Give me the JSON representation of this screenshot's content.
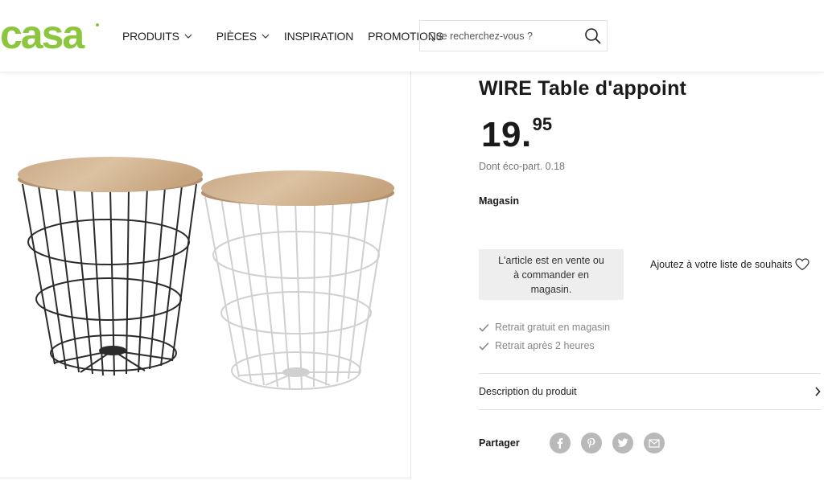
{
  "brand": {
    "logo_text": "casa",
    "accent": "#8cc63e"
  },
  "nav": {
    "items": [
      {
        "label": "PRODUITS",
        "has_dropdown": true
      },
      {
        "label": "PIÈCES",
        "has_dropdown": true
      },
      {
        "label": "INSPIRATION",
        "has_dropdown": false
      },
      {
        "label": "PROMOTIONS",
        "has_dropdown": false
      }
    ]
  },
  "search": {
    "placeholder": "Que recherchez-vous ?",
    "value": ""
  },
  "product": {
    "title": "WIRE Table d'appoint",
    "price_int": "19.",
    "price_dec": "95",
    "eco_part": "Dont éco-part. 0.18",
    "availability_label": "Magasin",
    "store_notice": "L'article est en vente ou à commander en magasin.",
    "wishlist_label": "Ajoutez à votre liste de souhaits",
    "features": [
      "Retrait gratuit en magasin",
      "Retrait après 2 heures"
    ],
    "description_label": "Description du produit",
    "share_label": "Partager",
    "social_icons": [
      "facebook-icon",
      "pinterest-icon",
      "twitter-icon",
      "email-icon"
    ]
  }
}
